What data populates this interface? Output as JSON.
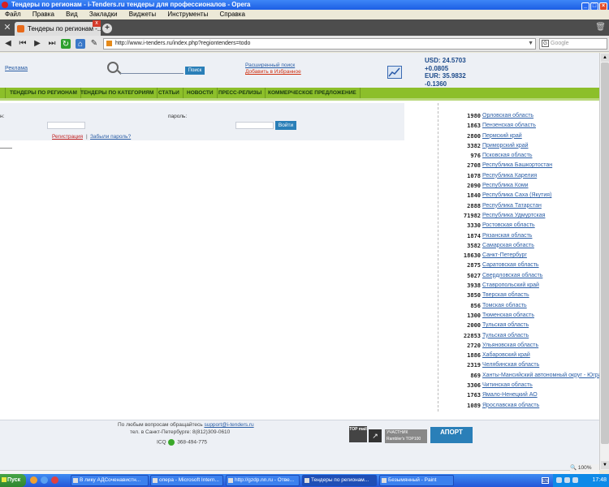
{
  "window": {
    "title": "Тендеры по регионам - i-Tenders.ru тендеры для профессионалов - Opera"
  },
  "menu": [
    "Файл",
    "Правка",
    "Вид",
    "Закладки",
    "Виджеты",
    "Инструменты",
    "Справка"
  ],
  "tab": {
    "label": "Тендеры по регионам -..."
  },
  "address": {
    "url": "http://www.i-tenders.ru/index.php?regiontenders=todo",
    "search_placeholder": "Google"
  },
  "header": {
    "ad_label": "Реклама",
    "search_button": "Поиск",
    "advanced_search": "Расширенный поиск",
    "add_favorites": "Добавить в Избранное",
    "rates": [
      "USD:  24.5703",
      "+0.0805",
      "EUR:  35.9832",
      "-0.1360"
    ]
  },
  "nav": [
    "ТЕНДЕРЫ ПО РЕГИОНАМ",
    "ТЕНДЕРЫ ПО КАТЕГОРИЯМ",
    "СТАТЬИ",
    "НОВОСТИ",
    "ПРЕСС-РЕЛИЗЫ",
    "КОММЕРЧЕСКОЕ ПРЕДЛОЖЕНИЕ"
  ],
  "login": {
    "login_label": "н:",
    "password_label": "пароль:",
    "submit": "Войти",
    "register": "Регистрация",
    "separator": "|",
    "forgot": "Забыли пароль?"
  },
  "regions": [
    {
      "count": "1980",
      "name": "Орловская область"
    },
    {
      "count": "1863",
      "name": "Пензенская область"
    },
    {
      "count": "2800",
      "name": "Пермский край"
    },
    {
      "count": "3382",
      "name": "Приморский край"
    },
    {
      "count": "976",
      "name": "Псковская область"
    },
    {
      "count": "2708",
      "name": "Республика Башкортостан"
    },
    {
      "count": "1078",
      "name": "Республика Карелия"
    },
    {
      "count": "2090",
      "name": "Республика Коми"
    },
    {
      "count": "1840",
      "name": "Республика Саха (Якутия)"
    },
    {
      "count": "2888",
      "name": "Республика Татарстан"
    },
    {
      "count": "71982",
      "name": "Республика Удмуртская"
    },
    {
      "count": "3330",
      "name": "Ростовская область"
    },
    {
      "count": "1874",
      "name": "Рязанская область"
    },
    {
      "count": "3582",
      "name": "Самарская область"
    },
    {
      "count": "18630",
      "name": "Санкт-Петербург"
    },
    {
      "count": "2875",
      "name": "Саратовская область"
    },
    {
      "count": "5027",
      "name": "Свердловская область"
    },
    {
      "count": "3938",
      "name": "Ставропольский край"
    },
    {
      "count": "3850",
      "name": "Тверская область"
    },
    {
      "count": "856",
      "name": "Томская область"
    },
    {
      "count": "1300",
      "name": "Тюменская область"
    },
    {
      "count": "2000",
      "name": "Тульская область"
    },
    {
      "count": "22853",
      "name": "Тульская область"
    },
    {
      "count": "2720",
      "name": "Ульяновская область"
    },
    {
      "count": "1886",
      "name": "Хабаровский край"
    },
    {
      "count": "2319",
      "name": "Челябинская область"
    },
    {
      "count": "869",
      "name": "Ханты-Мансийский автономный округ - Югра"
    },
    {
      "count": "3306",
      "name": "Читинская область"
    },
    {
      "count": "1763",
      "name": "Ямало-Ненецкий АО"
    },
    {
      "count": "1089",
      "name": "Ярославская область"
    }
  ],
  "footer": {
    "line1_prefix": "По любым вопросам обращайтесь",
    "email": "support@i-tenders.ru",
    "line2": "тел. в Санкт-Петербурге: 8(812)309-0610",
    "icq_label": "ICQ",
    "icq_number": "368-494-775",
    "counter1": "TOP mail",
    "counter2": "УЧАСТНИК Rambler's TOP100",
    "counter3": "АПОРТ"
  },
  "status": {
    "zoom": "100%"
  },
  "taskbar": {
    "start": "Пуск",
    "items": [
      {
        "label": "В лику АДСоченавистн...",
        "active": false
      },
      {
        "label": "опера - Microsoft Intern...",
        "active": false
      },
      {
        "label": "http://gzdp.nn.ru - Отве...",
        "active": false
      },
      {
        "label": "Тендеры по регионам...",
        "active": true
      },
      {
        "label": "Безымянный - Paint",
        "active": false
      }
    ],
    "lang": "EN",
    "time": "17:48"
  }
}
